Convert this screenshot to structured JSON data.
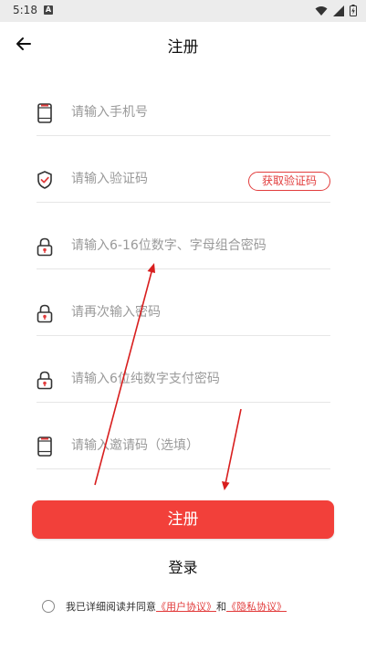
{
  "status_bar": {
    "time": "5:18",
    "a_icon_letter": "A"
  },
  "header": {
    "title": "注册"
  },
  "form": {
    "phone": {
      "placeholder": "请输入手机号",
      "value": ""
    },
    "code": {
      "placeholder": "请输入验证码",
      "value": "",
      "button_label": "获取验证码"
    },
    "password": {
      "placeholder": "请输入6-16位数字、字母组合密码",
      "value": ""
    },
    "password_confirm": {
      "placeholder": "请再次输入密码",
      "value": ""
    },
    "pay_password": {
      "placeholder": "请输入6位纯数字支付密码",
      "value": ""
    },
    "invite": {
      "placeholder": "请输入邀请码（选填）",
      "value": ""
    }
  },
  "actions": {
    "register_label": "注册",
    "login_label": "登录"
  },
  "agreement": {
    "prefix": "我已详细阅读并同意",
    "user_agreement": "《用户协议》",
    "joiner": "和",
    "privacy_agreement": "《隐私协议》",
    "checked": false
  },
  "colors": {
    "accent": "#f2403a",
    "link": "#e23d3d",
    "divider": "#e6e6e6",
    "placeholder": "#9a9a9a"
  }
}
